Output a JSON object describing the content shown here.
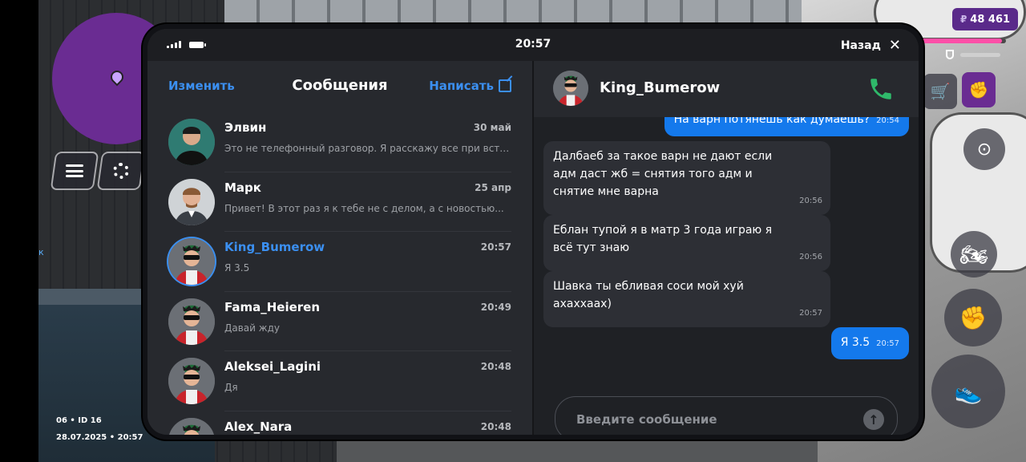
{
  "hud": {
    "money_symbol": "₽",
    "money": "48 461",
    "side_letter": "к",
    "player_id": "06 • ID 16",
    "datetime": "28.07.2025 • 20:57",
    "health_fraction": 0.95,
    "armor_fraction": 1.0
  },
  "phone": {
    "status": {
      "time": "20:57",
      "back_label": "Назад"
    },
    "list": {
      "edit_label": "Изменить",
      "title": "Сообщения",
      "write_label": "Написать",
      "chats": [
        {
          "name": "Элвин",
          "time": "30 май",
          "preview": "Это не телефонный разговор. Я расскажу все при встрече"
        },
        {
          "name": "Марк",
          "time": "25 апр",
          "preview": "Привет! В этот раз я к тебе не с делом, а с новостью..."
        },
        {
          "name": "King_Bumerow",
          "time": "20:57",
          "preview": "Я 3.5",
          "active": true
        },
        {
          "name": "Fama_Heieren",
          "time": "20:49",
          "preview": "Давай жду"
        },
        {
          "name": "Aleksei_Lagini",
          "time": "20:48",
          "preview": "Дя"
        },
        {
          "name": "Alex_Nara",
          "time": "20:48",
          "preview": ""
        }
      ]
    },
    "conversation": {
      "contact": "King_Bumerow",
      "messages": [
        {
          "dir": "out",
          "text": "На варн потянешь как думаешь?",
          "time": "20:54"
        },
        {
          "dir": "in",
          "text": "Далбаеб за такое варн не дают если адм даст жб = снятия того адм и снятие мне варна",
          "time": "20:56"
        },
        {
          "dir": "in",
          "text": "Еблан тупой я в матр 3 года играю я всё тут знаю",
          "time": "20:56"
        },
        {
          "dir": "in",
          "text": "Шавка ты ебливая соси мой хуй ахаххаах)",
          "time": "20:57"
        },
        {
          "dir": "out",
          "text": "Я 3.5",
          "time": "20:57"
        }
      ],
      "input_placeholder": "Введите сообщение"
    }
  },
  "colors": {
    "accent": "#3b8ff0",
    "outgoing_bubble": "#1479ec",
    "call_green": "#2fb96a",
    "minimap": "#6a2c92"
  }
}
